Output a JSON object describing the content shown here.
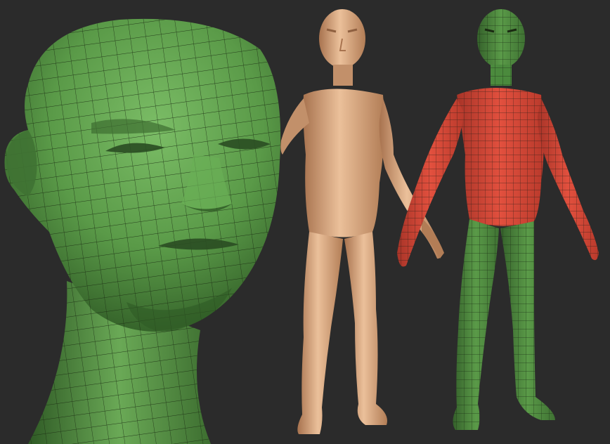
{
  "scene": {
    "background": "#2b2b2b",
    "colors": {
      "head_mesh": "#5a9a48",
      "head_mesh_light": "#7bbd66",
      "head_mesh_shadow": "#2f5a25",
      "skin": "#d5a07a",
      "skin_light": "#ebc09a",
      "skin_shadow": "#8f6040",
      "topo_torso": "#e2503e",
      "topo_torso_shadow": "#a83428",
      "topo_legs": "#5a9a48",
      "wireframe": "#1a2a12"
    },
    "panels": [
      {
        "name": "head-closeup",
        "description_icon": "green-wireframe-head"
      },
      {
        "name": "body-shaded",
        "description_icon": "skin-shaded-body"
      },
      {
        "name": "body-topology",
        "description_icon": "polygroup-wireframe-body"
      }
    ]
  }
}
